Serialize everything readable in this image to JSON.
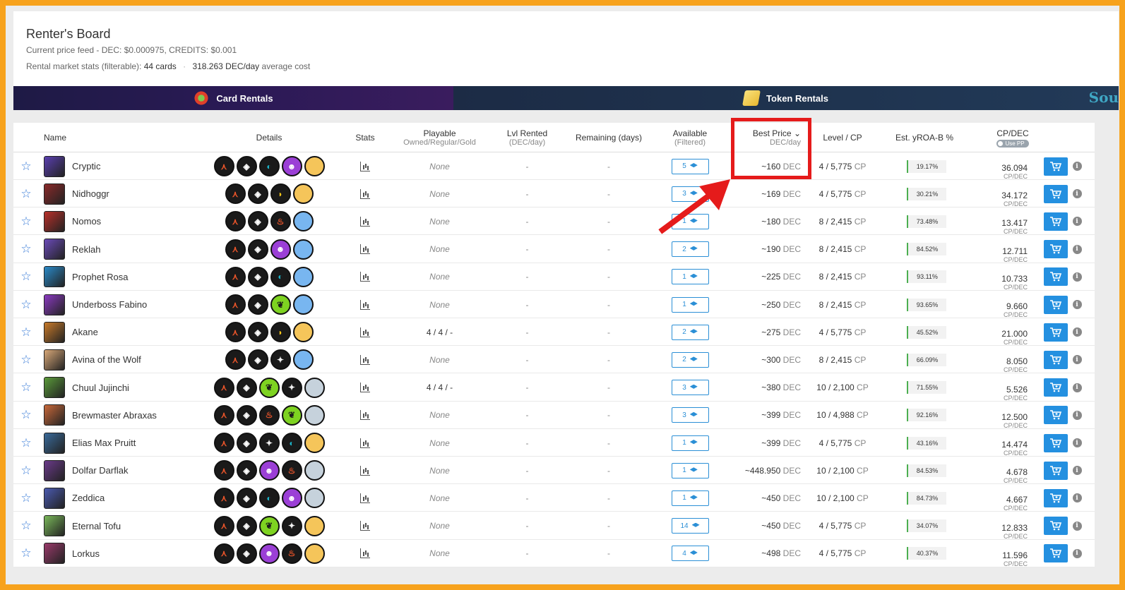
{
  "header": {
    "title": "Renter's Board",
    "price_feed": "Current price feed - DEC: $0.000975, CREDITS: $0.001",
    "stats_label": "Rental market stats (filterable):",
    "stats_cards": "44 cards",
    "stats_sep": "·",
    "stats_cost": "318.263 DEC/day",
    "stats_cost_suffix": "average cost"
  },
  "tabs": [
    {
      "label": "Card Rentals",
      "icon": "card-rentals-icon"
    },
    {
      "label": "Token Rentals",
      "icon": "token-rentals-icon"
    }
  ],
  "tab_logo_text": "Sou",
  "columns": {
    "name": "Name",
    "details": "Details",
    "stats": "Stats",
    "playable": "Playable",
    "playable_sub": "Owned/Regular/Gold",
    "lvl_rented": "Lvl Rented",
    "lvl_rented_sub": "(DEC/day)",
    "remaining": "Remaining (days)",
    "available": "Available",
    "available_sub": "(Filtered)",
    "best_price": "Best Price ⌄",
    "best_price_sub": "DEC/day",
    "level_cp": "Level / CP",
    "yroa": "Est. yROA-B %",
    "cpdec": "CP/DEC",
    "use_pp": "Use PP"
  },
  "units": {
    "dec": "DEC",
    "cp": "CP",
    "cpdec": "CP/DEC"
  },
  "colors": {
    "fire": "#e8542a",
    "water": "#1bb5c9",
    "earth": "#7ed321",
    "life": "#f0f0f0",
    "death": "#9b3fd6",
    "dragon": "#f5c518",
    "neutral": "#ffffff",
    "gold_rarity": "#f5c55a",
    "blue_rarity": "#78b6f0",
    "silver_rarity": "#c6d2dc"
  },
  "rows": [
    {
      "name": "Cryptic",
      "badges": [
        "edition",
        "gem",
        "water",
        "death",
        "gold"
      ],
      "playable": "None",
      "lvl_rented": "-",
      "remaining": "-",
      "available": "5",
      "price": "~160",
      "level": "4 / 5,775",
      "roa": "19.17%",
      "cpdec": "36.094",
      "avatar": "#5a3fb0"
    },
    {
      "name": "Nidhoggr",
      "badges": [
        "edition",
        "gem",
        "dragon",
        "gold"
      ],
      "playable": "None",
      "lvl_rented": "-",
      "remaining": "-",
      "available": "3",
      "price": "~169",
      "level": "4 / 5,775",
      "roa": "30.21%",
      "cpdec": "34.172",
      "avatar": "#8a2a2a"
    },
    {
      "name": "Nomos",
      "badges": [
        "edition",
        "gem",
        "fire",
        "blue"
      ],
      "playable": "None",
      "lvl_rented": "-",
      "remaining": "-",
      "available": "1",
      "price": "~180",
      "level": "8 / 2,415",
      "roa": "73.48%",
      "cpdec": "13.417",
      "avatar": "#b8302a"
    },
    {
      "name": "Reklah",
      "badges": [
        "edition",
        "gem",
        "death",
        "blue"
      ],
      "playable": "None",
      "lvl_rented": "-",
      "remaining": "-",
      "available": "2",
      "price": "~190",
      "level": "8 / 2,415",
      "roa": "84.52%",
      "cpdec": "12.711",
      "avatar": "#6a4ab8"
    },
    {
      "name": "Prophet Rosa",
      "badges": [
        "edition",
        "gem",
        "water",
        "blue"
      ],
      "playable": "None",
      "lvl_rented": "-",
      "remaining": "-",
      "available": "1",
      "price": "~225",
      "level": "8 / 2,415",
      "roa": "93.11%",
      "cpdec": "10.733",
      "avatar": "#2a8ac8"
    },
    {
      "name": "Underboss Fabino",
      "badges": [
        "edition",
        "gem",
        "earth",
        "blue"
      ],
      "playable": "None",
      "lvl_rented": "-",
      "remaining": "-",
      "available": "1",
      "price": "~250",
      "level": "8 / 2,415",
      "roa": "93.65%",
      "cpdec": "9.660",
      "avatar": "#8a3ac0"
    },
    {
      "name": "Akane",
      "badges": [
        "edition",
        "gem",
        "dragon",
        "gold"
      ],
      "playable": "4 / 4 / -",
      "lvl_rented": "-",
      "remaining": "-",
      "available": "2",
      "price": "~275",
      "level": "4 / 5,775",
      "roa": "45.52%",
      "cpdec": "21.000",
      "avatar": "#c87a2a"
    },
    {
      "name": "Avina of the Wolf",
      "badges": [
        "edition",
        "gem",
        "life",
        "blue"
      ],
      "playable": "None",
      "lvl_rented": "-",
      "remaining": "-",
      "available": "2",
      "price": "~300",
      "level": "8 / 2,415",
      "roa": "66.09%",
      "cpdec": "8.050",
      "avatar": "#d8a878"
    },
    {
      "name": "Chuul Jujinchi",
      "badges": [
        "edition",
        "gem",
        "earth",
        "life",
        "silver"
      ],
      "playable": "4 / 4 / -",
      "lvl_rented": "-",
      "remaining": "-",
      "available": "3",
      "price": "~380",
      "level": "10 / 2,100",
      "roa": "71.55%",
      "cpdec": "5.526",
      "avatar": "#5a9a3a"
    },
    {
      "name": "Brewmaster Abraxas",
      "badges": [
        "edition",
        "gem",
        "fire",
        "earth",
        "silver"
      ],
      "playable": "None",
      "lvl_rented": "-",
      "remaining": "-",
      "available": "3",
      "price": "~399",
      "level": "10 / 4,988",
      "roa": "92.16%",
      "cpdec": "12.500",
      "avatar": "#c8683a"
    },
    {
      "name": "Elias Max Pruitt",
      "badges": [
        "edition",
        "gem",
        "life",
        "water",
        "gold"
      ],
      "playable": "None",
      "lvl_rented": "-",
      "remaining": "-",
      "available": "1",
      "price": "~399",
      "level": "4 / 5,775",
      "roa": "43.16%",
      "cpdec": "14.474",
      "avatar": "#3a6a9a"
    },
    {
      "name": "Dolfar Darflak",
      "badges": [
        "edition",
        "gem",
        "death",
        "fire",
        "silver"
      ],
      "playable": "None",
      "lvl_rented": "-",
      "remaining": "-",
      "available": "1",
      "price": "~448.950",
      "level": "10 / 2,100",
      "roa": "84.53%",
      "cpdec": "4.678",
      "avatar": "#6a3a8a"
    },
    {
      "name": "Zeddica",
      "badges": [
        "edition",
        "gem",
        "water",
        "death",
        "silver"
      ],
      "playable": "None",
      "lvl_rented": "-",
      "remaining": "-",
      "available": "1",
      "price": "~450",
      "level": "10 / 2,100",
      "roa": "84.73%",
      "cpdec": "4.667",
      "avatar": "#4a5ab0"
    },
    {
      "name": "Eternal Tofu",
      "badges": [
        "edition",
        "gem",
        "earth",
        "life",
        "gold"
      ],
      "playable": "None",
      "lvl_rented": "-",
      "remaining": "-",
      "available": "14",
      "price": "~450",
      "level": "4 / 5,775",
      "roa": "34.07%",
      "cpdec": "12.833",
      "avatar": "#7ab85a"
    },
    {
      "name": "Lorkus",
      "badges": [
        "edition",
        "gem",
        "death",
        "fire",
        "gold"
      ],
      "playable": "None",
      "lvl_rented": "-",
      "remaining": "-",
      "available": "4",
      "price": "~498",
      "level": "4 / 5,775",
      "roa": "40.37%",
      "cpdec": "11.596",
      "avatar": "#9a3a6a"
    }
  ]
}
